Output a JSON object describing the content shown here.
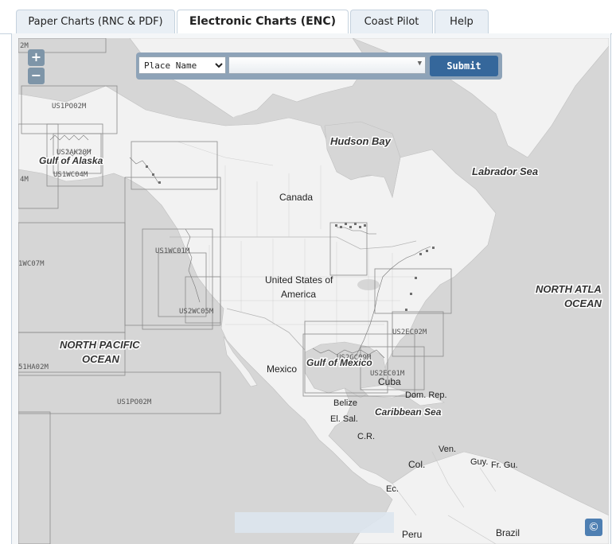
{
  "tabs": [
    {
      "label": "Paper Charts (RNC & PDF)",
      "active": false
    },
    {
      "label": "Electronic Charts (ENC)",
      "active": true
    },
    {
      "label": "Coast Pilot",
      "active": false
    },
    {
      "label": "Help",
      "active": false
    }
  ],
  "zoom": {
    "in": "+",
    "out": "−"
  },
  "search": {
    "type_selected": "Place Name",
    "type_options": [
      "Place Name"
    ],
    "place_value": "",
    "submit": "Submit"
  },
  "map_labels": {
    "hudson_bay": "Hudson Bay",
    "labrador_sea": "Labrador Sea",
    "gulf_of_alaska": "Gulf of Alaska",
    "canada": "Canada",
    "usa_line1": "United States of",
    "usa_line2": "America",
    "north_atlantic_1": "NORTH ATLA",
    "north_atlantic_2": "OCEAN",
    "north_pacific_1": "NORTH PACIFIC",
    "north_pacific_2": "OCEAN",
    "mexico": "Mexico",
    "gulf_of_mexico": "Gulf of Mexico",
    "cuba": "Cuba",
    "dom_rep": "Dom. Rep.",
    "belize": "Belize",
    "el_sal": "El. Sal.",
    "caribbean_sea": "Caribbean Sea",
    "cr": "C.R.",
    "ven": "Ven.",
    "col": "Col.",
    "guy": "Guy.",
    "fr_gu": "Fr. Gu.",
    "ec": "Ec.",
    "peru": "Peru",
    "brazil": "Brazil"
  },
  "chart_labels": {
    "c2m": "2M",
    "us1po02m_top": "US1PO02M",
    "us2ak20m": "US2AK20M",
    "us1wc04m": "US1WC04M",
    "c4m": "4M",
    "us1wc07m": "1WC07M",
    "us1wc01m": "US1WC01M",
    "us2wc05m": "US2WC05M",
    "us2ec02m": "US2EC02M",
    "us2gc09m": "US2GC09M",
    "us2ec01m": "US2EC01M",
    "us1ha02m": "51HA02M",
    "us1po02m_bottom": "US1PO02M"
  },
  "copyright_icon": "©"
}
